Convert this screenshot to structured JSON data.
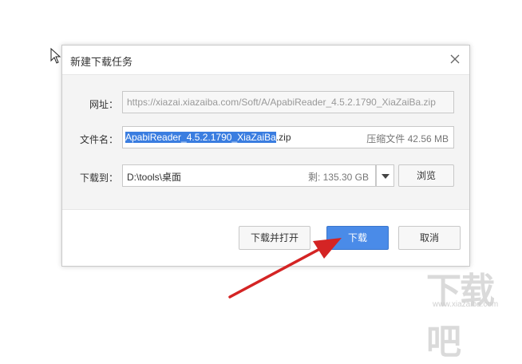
{
  "dialog": {
    "title": "新建下载任务",
    "url_label": "网址：",
    "url_value": "https://xiazai.xiazaiba.com/Soft/A/ApabiReader_4.5.2.1790_XiaZaiBa.zip",
    "filename_label": "文件名：",
    "filename_selected": "ApabiReader_4.5.2.1790_XiaZaiBa",
    "filename_ext": ".zip",
    "file_info": "压缩文件 42.56 MB",
    "download_to_label": "下载到：",
    "path_value": "D:\\tools\\桌面",
    "free_space": "剩: 135.30 GB",
    "browse_label": "浏览",
    "download_open_label": "下载并打开",
    "download_label": "下载",
    "cancel_label": "取消"
  },
  "watermark": {
    "text": "下载吧",
    "url": "www.xiazaiba.com"
  },
  "colors": {
    "selection": "#3a7de0",
    "primary_button": "#4a8be8",
    "arrow": "#d42424"
  }
}
